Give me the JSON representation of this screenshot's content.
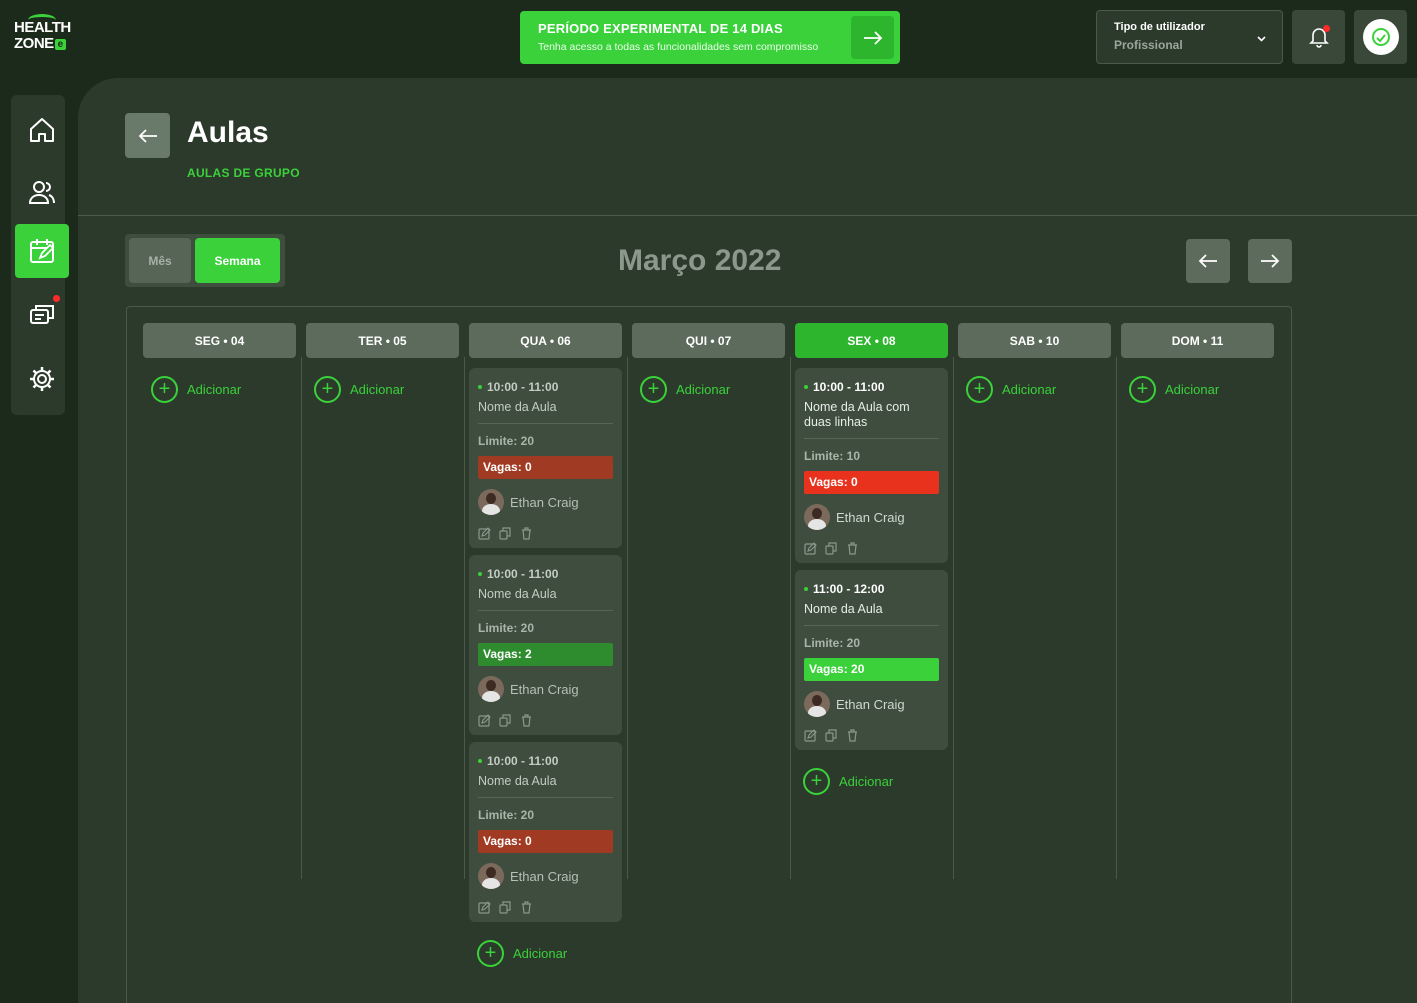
{
  "logo": {
    "line1": "HEALTH",
    "line2": "ZONE",
    "badge": "e"
  },
  "trial": {
    "title": "PERÍODO EXPERIMENTAL DE 14 DIAS",
    "subtitle": "Tenha acesso a todas as funcionalidades sem compromisso"
  },
  "user_type": {
    "label": "Tipo de utilizador",
    "value": "Profissional"
  },
  "sidebar": {
    "items": [
      {
        "name": "home",
        "icon": "home-icon"
      },
      {
        "name": "users",
        "icon": "users-icon"
      },
      {
        "name": "calendar",
        "icon": "calendar-icon",
        "active": true
      },
      {
        "name": "messages",
        "icon": "chat-icon",
        "badge": true
      },
      {
        "name": "settings",
        "icon": "gear-icon"
      }
    ]
  },
  "page": {
    "title": "Aulas",
    "subtitle": "AULAS DE GRUPO"
  },
  "view_toggle": {
    "month": "Mês",
    "week": "Semana",
    "selected": "week"
  },
  "calendar_title": "Março 2022",
  "add_label": "Adicionar",
  "days": [
    {
      "label": "SEG • 04",
      "classes": []
    },
    {
      "label": "TER • 05",
      "classes": []
    },
    {
      "label": "QUA • 06",
      "classes": [
        {
          "time": "10:00 - 11:00",
          "name": "Nome da Aula",
          "limit": "Limite: 20",
          "vagas": "Vagas: 0",
          "status": "full-dim",
          "instructor": "Ethan Craig"
        },
        {
          "time": "10:00 - 11:00",
          "name": "Nome da Aula",
          "limit": "Limite: 20",
          "vagas": "Vagas: 2",
          "status": "available-dim",
          "instructor": "Ethan Craig"
        },
        {
          "time": "10:00 - 11:00",
          "name": "Nome da Aula",
          "limit": "Limite: 20",
          "vagas": "Vagas: 0",
          "status": "full-dim",
          "instructor": "Ethan Craig"
        }
      ]
    },
    {
      "label": "QUI • 07",
      "classes": []
    },
    {
      "label": "SEX • 08",
      "today": true,
      "classes": [
        {
          "time": "10:00 - 11:00",
          "name": "Nome da Aula com duas linhas",
          "limit": "Limite: 10",
          "vagas": "Vagas: 0",
          "status": "full",
          "instructor": "Ethan Craig"
        },
        {
          "time": "11:00 - 12:00",
          "name": "Nome da Aula",
          "limit": "Limite: 20",
          "vagas": "Vagas: 20",
          "status": "available",
          "instructor": "Ethan Craig"
        }
      ]
    },
    {
      "label": "SAB • 10",
      "classes": []
    },
    {
      "label": "DOM • 11",
      "classes": []
    }
  ],
  "colors": {
    "accent": "#3ad13a",
    "full": "#e8321e",
    "full_dim": "#a13a22",
    "available": "#3ad13a",
    "available_dim": "#2e8c2e"
  }
}
